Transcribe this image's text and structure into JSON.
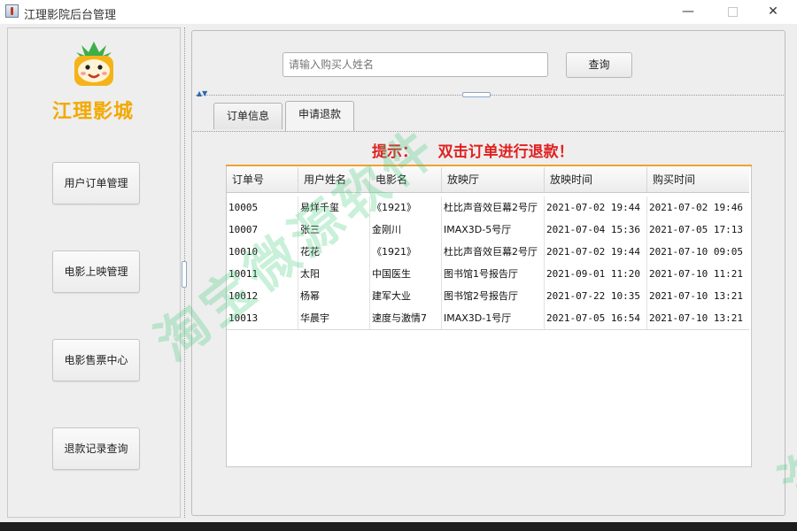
{
  "window": {
    "title": "江理影院后台管理",
    "min_glyph": "—",
    "close_glyph": "✕",
    "icon": "java-cup-icon"
  },
  "sidebar": {
    "logo_icon": "monkey-logo-icon",
    "brand": "江理影城",
    "items": [
      {
        "label": "用户订单管理"
      },
      {
        "label": "电影上映管理"
      },
      {
        "label": "电影售票中心"
      },
      {
        "label": "退款记录查询"
      }
    ]
  },
  "search": {
    "placeholder": "请输入购买人姓名",
    "button_label": "查询"
  },
  "tabs": [
    {
      "label": "订单信息",
      "selected": false
    },
    {
      "label": "申请退款",
      "selected": true
    }
  ],
  "hint": "提示：    双击订单进行退款！",
  "table": {
    "columns": [
      "订单号",
      "用户姓名",
      "电影名",
      "放映厅",
      "放映时间",
      "购买时间"
    ],
    "rows": [
      [
        "10005",
        "易烊千玺",
        "《1921》",
        "杜比声音效巨幕2号厅",
        "2021-07-02 19:44",
        "2021-07-02 19:46"
      ],
      [
        "10007",
        "张三",
        "金刚川",
        "IMAX3D-5号厅",
        "2021-07-04 15:36",
        "2021-07-05 17:13"
      ],
      [
        "10010",
        "花花",
        "《1921》",
        "杜比声音效巨幕2号厅",
        "2021-07-02 19:44",
        "2021-07-10 09:05"
      ],
      [
        "10011",
        "太阳",
        "中国医生",
        "图书馆1号报告厅",
        "2021-09-01 11:20",
        "2021-07-10 11:21"
      ],
      [
        "10012",
        "杨幂",
        "建军大业",
        "图书馆2号报告厅",
        "2021-07-22 10:35",
        "2021-07-10 13:21"
      ],
      [
        "10013",
        "华晨宇",
        "速度与激情7",
        "IMAX3D-1号厅",
        "2021-07-05 16:54",
        "2021-07-10 13:21"
      ]
    ]
  },
  "watermark": "淘宝微源软件",
  "colors": {
    "brand": "#f2a900",
    "hint": "#e02020",
    "table_accent": "#f0a030",
    "watermark": "#3cc878"
  }
}
